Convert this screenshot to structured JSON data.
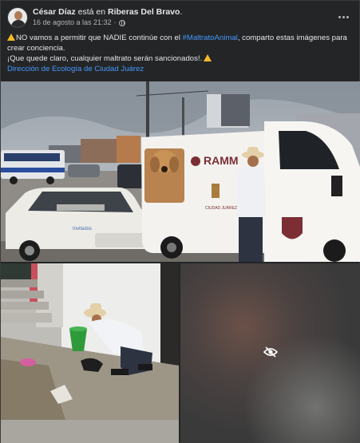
{
  "post": {
    "author": "César Díaz",
    "connector": " está en ",
    "place": "Riberas Del Bravo",
    "place_suffix": ".",
    "timestamp": "16 de agosto a las 21:32",
    "separator": "·",
    "privacy_icon": "globe-icon",
    "more_icon": "more-options-icon",
    "text": {
      "l1_a": "NO vamos a permitir que NADIE continúe con el ",
      "hashtag": "#MaltratoAnimal",
      "l1_b": ", comparto estas imágenes para crear conciencia.",
      "l2": "¡Que quede claro, cualquier maltrato serán sancionados!.",
      "link": "Dirección de Ecología de Ciudad Juárez"
    }
  },
  "photos": {
    "van_brand": "RAMM",
    "van_sub": "CIUDAD JUÁREZ",
    "windshield_text": "Invitados",
    "sensitive_icon": "eye-slash-icon"
  },
  "colors": {
    "background": "#242526",
    "text": "#e4e6eb",
    "secondary": "#b0b3b8",
    "link": "#4599ff",
    "warning": "#f7b928"
  }
}
